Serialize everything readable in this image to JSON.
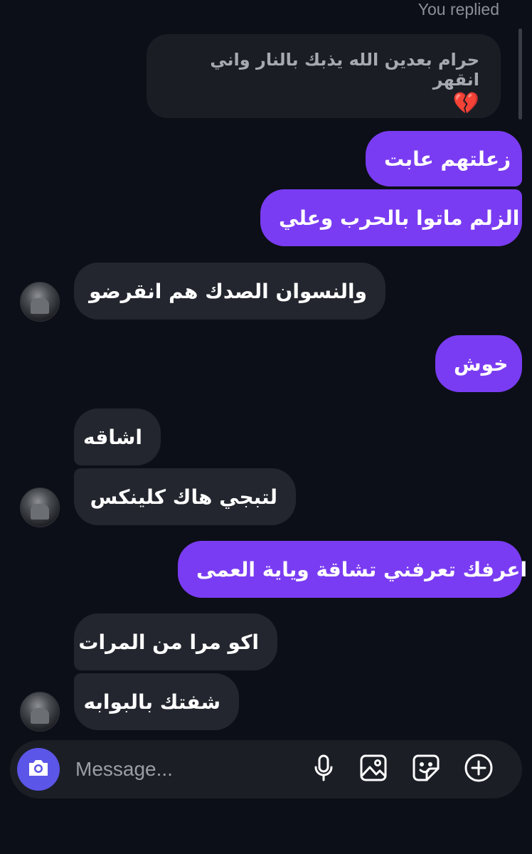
{
  "header": {
    "replied_label": "You replied"
  },
  "quoted_message": {
    "text": "حرام بعدين الله يذبك بالنار واني انقهر",
    "emoji": "💔"
  },
  "messages": [
    {
      "text": "زعلتهم عابت"
    },
    {
      "text": "الزلم ماتوا بالحرب وعلي"
    },
    {
      "text": "والنسوان  الصدك هم انقرضو"
    },
    {
      "text": "خوش"
    },
    {
      "text": "اشاقه"
    },
    {
      "text": "لتبجي هاك كلينكس"
    },
    {
      "text": "اعرفك تعرفني تشاقة وياية العمى"
    },
    {
      "text": "اكو مرا من المرات"
    },
    {
      "text": "شفتك بالبوابه"
    }
  ],
  "composer": {
    "placeholder": "Message...",
    "icons": [
      "camera-icon",
      "microphone-icon",
      "gallery-icon",
      "sticker-icon",
      "add-icon"
    ]
  },
  "colors": {
    "sent_bubble": "#7a3cf2",
    "received_bubble": "#23262e",
    "background": "#0c0f17",
    "camera_button": "#5b55e8"
  }
}
